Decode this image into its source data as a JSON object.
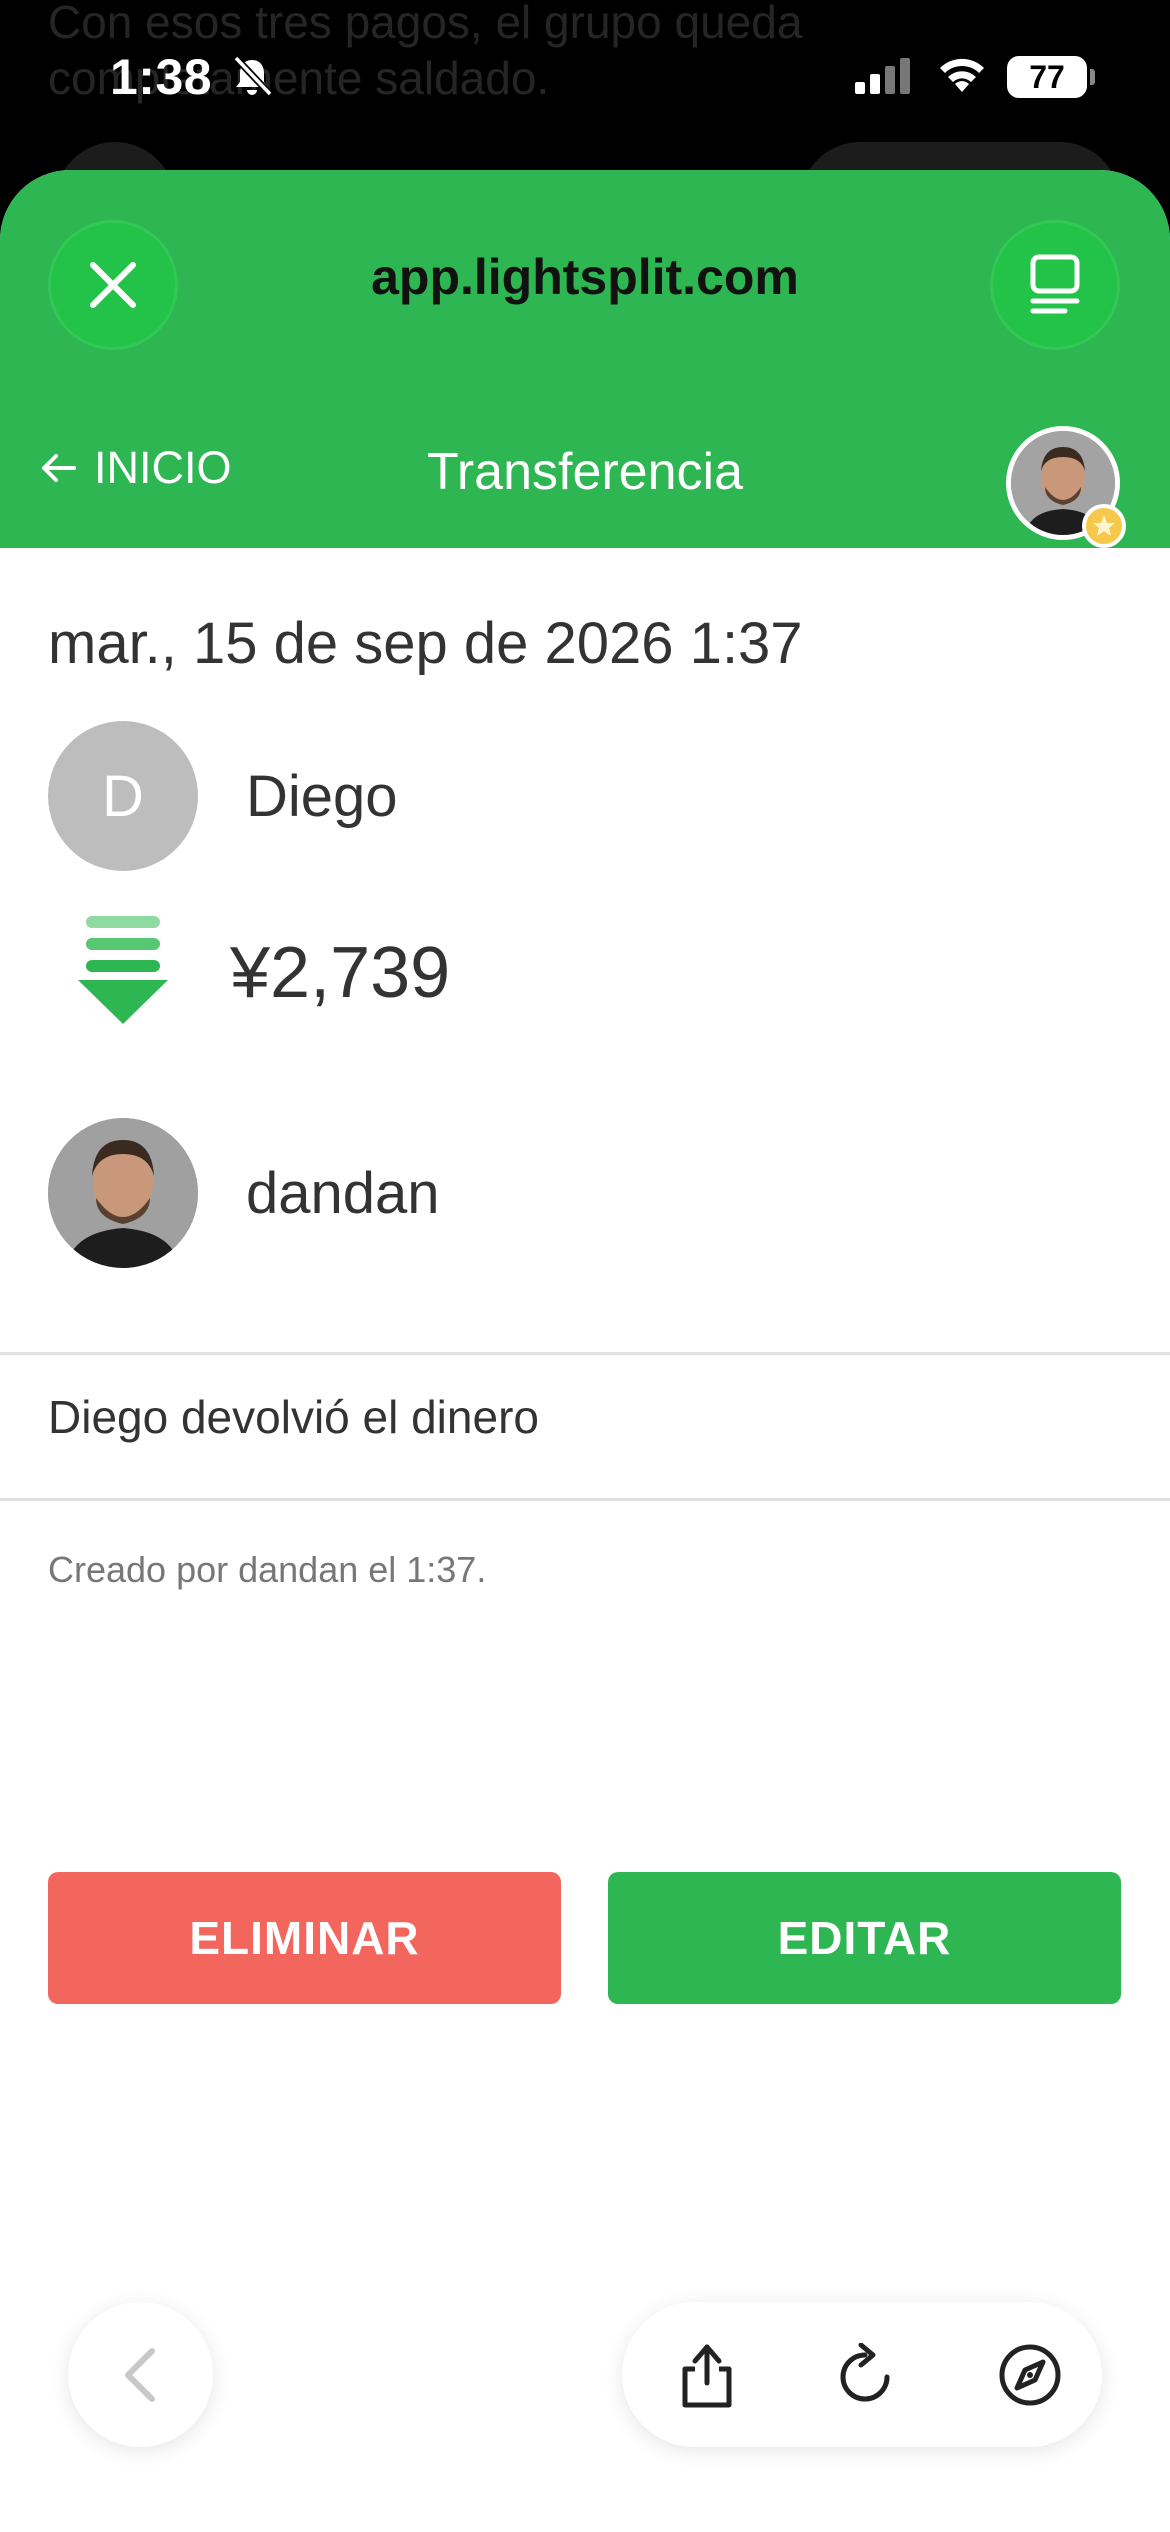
{
  "background": {
    "line1": "Con esos tres pagos, el grupo queda",
    "line2": "completamente saldado."
  },
  "status_bar": {
    "time": "1:38",
    "battery": "77"
  },
  "browser": {
    "url": "app.lightsplit.com"
  },
  "header": {
    "back_label": "INICIO",
    "title": "Transferencia"
  },
  "transfer": {
    "datetime": "mar., 15 de sep de 2026 1:37",
    "from_initial": "D",
    "from_name": "Diego",
    "amount": "¥2,739",
    "to_name": "dandan",
    "note": "Diego devolvió el dinero",
    "created": "Creado por dandan el 1:37."
  },
  "actions": {
    "delete_label": "ELIMINAR",
    "edit_label": "EDITAR"
  },
  "colors": {
    "brand_green": "#2db651",
    "danger_red": "#f3665e"
  },
  "icons": [
    "close-icon",
    "tabs-icon",
    "arrow-left-icon",
    "transfer-down-icon",
    "star-badge-icon",
    "chevron-left-icon",
    "share-icon",
    "reload-icon",
    "compass-icon",
    "bell-slash-icon",
    "signal-icon",
    "wifi-icon"
  ]
}
